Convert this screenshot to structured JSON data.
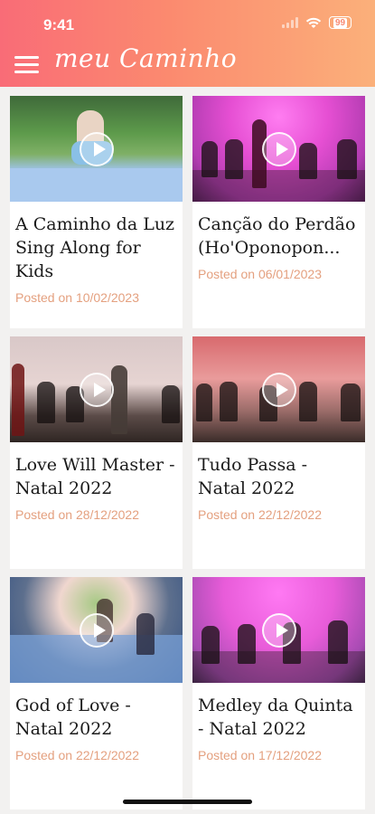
{
  "status_bar": {
    "time": "9:41",
    "battery": "99"
  },
  "app": {
    "title": "meu Caminho"
  },
  "videos": [
    {
      "title": "A Caminho da Luz Sing Along for Kids",
      "date": "Posted on 10/02/2023"
    },
    {
      "title": "Canção do Perdão (Ho'Oponopon...",
      "date": "Posted on 06/01/2023"
    },
    {
      "title": "Love Will Master - Natal 2022",
      "date": "Posted on 28/12/2022"
    },
    {
      "title": "Tudo Passa - Natal 2022",
      "date": "Posted on 22/12/2022"
    },
    {
      "title": "God of Love - Natal 2022",
      "date": "Posted on 22/12/2022"
    },
    {
      "title": "Medley da Quinta - Natal 2022",
      "date": "Posted on 17/12/2022"
    }
  ],
  "icons": [
    "menu-icon",
    "play-icon",
    "wifi-icon",
    "signal-icon",
    "battery-icon"
  ]
}
